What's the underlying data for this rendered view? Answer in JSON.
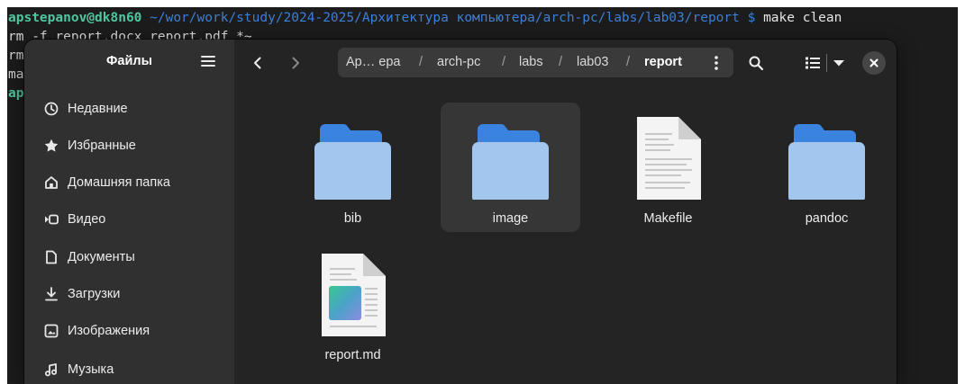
{
  "terminal": {
    "prompt_user": "apstepanov@dk8n60",
    "prompt_path": "~/wor/work/study/2024-2025/Архитектура компьютера/arch-pc/labs/lab03/report $",
    "command": "make clean",
    "line2": "rm -f report.docx report.pdf *~",
    "line3": "rm",
    "line4": "ma",
    "line5_user": "ap"
  },
  "sidebar": {
    "title": "Файлы",
    "items": [
      {
        "label": "Недавние",
        "icon": "clock-icon"
      },
      {
        "label": "Избранные",
        "icon": "star-icon"
      },
      {
        "label": "Домашняя папка",
        "icon": "home-icon"
      },
      {
        "label": "Видео",
        "icon": "video-icon"
      },
      {
        "label": "Документы",
        "icon": "document-icon"
      },
      {
        "label": "Загрузки",
        "icon": "download-icon"
      },
      {
        "label": "Изображения",
        "icon": "image-icon"
      },
      {
        "label": "Музыка",
        "icon": "music-icon"
      }
    ]
  },
  "pathbar": {
    "crumbs": [
      "Ар… ера",
      "arch-pc",
      "labs",
      "lab03",
      "report"
    ],
    "separator": "/"
  },
  "files": [
    {
      "name": "bib",
      "type": "folder",
      "selected": false
    },
    {
      "name": "image",
      "type": "folder",
      "selected": true
    },
    {
      "name": "Makefile",
      "type": "text",
      "selected": false
    },
    {
      "name": "pandoc",
      "type": "folder",
      "selected": false
    },
    {
      "name": "report.md",
      "type": "markdown",
      "selected": false
    }
  ],
  "colors": {
    "folder_back": "#3a84e0",
    "folder_front": "#a3c6ef",
    "sidebar_bg": "#303030",
    "main_bg": "#242424",
    "terminal_user": "#4ec7a0",
    "terminal_path": "#3b7fd8"
  }
}
